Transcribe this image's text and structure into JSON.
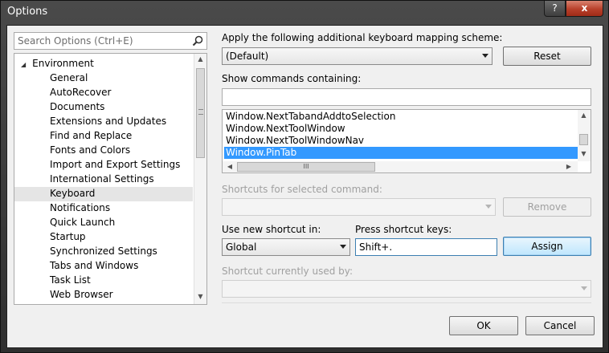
{
  "window": {
    "title": "Options",
    "help_label": "?",
    "close_label": "x"
  },
  "search": {
    "placeholder": "Search Options (Ctrl+E)"
  },
  "tree": {
    "root": {
      "label": "Environment",
      "expander": "◢"
    },
    "items": [
      {
        "label": "General"
      },
      {
        "label": "AutoRecover"
      },
      {
        "label": "Documents"
      },
      {
        "label": "Extensions and Updates"
      },
      {
        "label": "Find and Replace"
      },
      {
        "label": "Fonts and Colors"
      },
      {
        "label": "Import and Export Settings"
      },
      {
        "label": "International Settings"
      },
      {
        "label": "Keyboard",
        "selected": true
      },
      {
        "label": "Notifications"
      },
      {
        "label": "Quick Launch"
      },
      {
        "label": "Startup"
      },
      {
        "label": "Synchronized Settings"
      },
      {
        "label": "Tabs and Windows"
      },
      {
        "label": "Task List"
      },
      {
        "label": "Web Browser"
      }
    ]
  },
  "mapping": {
    "label": "Apply the following additional keyboard mapping scheme:",
    "value": "(Default)",
    "reset_label": "Reset"
  },
  "show_commands": {
    "label": "Show commands containing:",
    "value": ""
  },
  "commands": {
    "items": [
      {
        "label": "Window.NextTabandAddtoSelection"
      },
      {
        "label": "Window.NextToolWindow"
      },
      {
        "label": "Window.NextToolWindowNav"
      },
      {
        "label": "Window.PinTab",
        "selected": true
      }
    ],
    "hscroll_grip": "III"
  },
  "shortcuts_selected": {
    "label": "Shortcuts for selected command:",
    "value": "",
    "remove_label": "Remove"
  },
  "use_shortcut": {
    "label": "Use new shortcut in:",
    "value": "Global"
  },
  "press_keys": {
    "label": "Press shortcut keys:",
    "value": "Shift+."
  },
  "assign_label": "Assign",
  "currently_used": {
    "label": "Shortcut currently used by:",
    "value": ""
  },
  "footer": {
    "ok_label": "OK",
    "cancel_label": "Cancel"
  },
  "colors": {
    "selection": "#3399ff",
    "close": "#c0432c",
    "focus_border": "#3c7fb1"
  }
}
